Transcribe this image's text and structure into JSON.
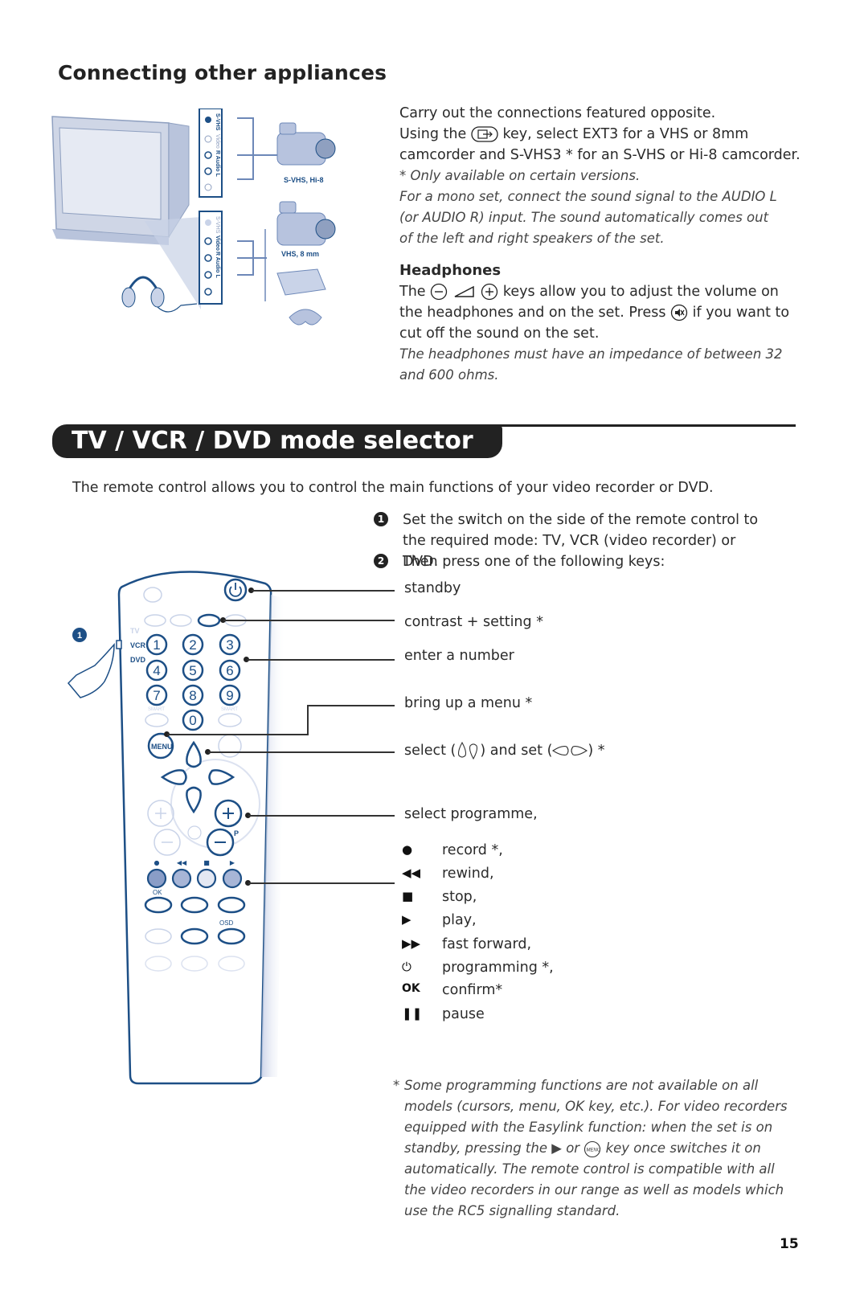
{
  "section1": {
    "title": "Connecting other appliances",
    "intro_line1": "Carry out the connections featured opposite.",
    "intro_line2_pre": "Using the",
    "intro_line2_post": "key, select EXT3 for a VHS or 8mm",
    "intro_line3": "camcorder and S-VHS3 * for an S-VHS or Hi-8 camcorder.",
    "note_versions": "* Only available on certain versions.",
    "mono_note": "For a mono set, connect the sound signal to the AUDIO L (or AUDIO R) input. The sound automatically comes out of the left and right speakers of the set.",
    "headphones_heading": "Headphones",
    "headphones_line1_pre": "The",
    "headphones_line1_post": "keys allow you to adjust the volume on",
    "headphones_line2_pre": "the headphones and on the set. Press",
    "headphones_line2_post": "if you want to",
    "headphones_line3": "cut off the sound on the set.",
    "impedance_note": "The headphones must have an impedance of between 32 and 600 ohms.",
    "icons": {
      "ext_key": "av-input-key-icon",
      "vol_minus": "minus-key-icon",
      "vol_wedge": "volume-icon",
      "vol_plus": "plus-key-icon",
      "mute": "mute-key-icon"
    },
    "illustration": {
      "panel_top_labels": [
        "S-VHS",
        "Video",
        "R Audio L"
      ],
      "panel_bottom_labels": [
        "S-VHS",
        "Video",
        "R Audio L"
      ],
      "caption_top": "S-VHS, Hi-8",
      "caption_bottom": "VHS, 8 mm"
    }
  },
  "section2": {
    "title": "TV / VCR / DVD mode selector",
    "lead": "The remote control allows you to control the main functions of your video recorder or DVD.",
    "steps": [
      {
        "num": "1",
        "text": "Set the switch on the side of the remote control to the required mode: TV, VCR (video recorder) or DVD."
      },
      {
        "num": "2",
        "text": "Then press one of the following keys:"
      }
    ],
    "callouts": [
      {
        "label": "standby"
      },
      {
        "label": "contrast + setting *"
      },
      {
        "label": "enter a number"
      },
      {
        "label": "bring up a menu *"
      },
      {
        "label_pre": "select (",
        "label_mid": ") and set (",
        "label_post": ") *"
      },
      {
        "label": "select programme,"
      }
    ],
    "legend": [
      {
        "symbol": "●",
        "icon": "record-icon",
        "text": "record *,"
      },
      {
        "symbol": "◀◀",
        "icon": "rewind-icon",
        "text": "rewind,"
      },
      {
        "symbol": "■",
        "icon": "stop-icon",
        "text": "stop,"
      },
      {
        "symbol": "▶",
        "icon": "play-icon",
        "text": "play,"
      },
      {
        "symbol": "▶▶",
        "icon": "fast-forward-icon",
        "text": "fast forward,"
      },
      {
        "symbol": "⏻",
        "icon": "timer-icon",
        "text": "programming *,"
      },
      {
        "symbol": "OK",
        "icon": "ok-icon",
        "text": "confirm*"
      },
      {
        "symbol": "❚❚",
        "icon": "pause-icon",
        "text": "pause"
      }
    ],
    "footnote_star": "*",
    "footnote_part1": "Some programming functions are not available on all models (cursors, menu, OK key, etc.). For video recorders equipped with the Easylink function: when the set is on standby, pressing the",
    "footnote_play": "▶",
    "footnote_or": "or",
    "footnote_part2": "key once switches it on automatically. The remote control is compatible with all the video recorders in our range as well as models which use the RC5 signalling standard.",
    "remote": {
      "switch_labels": [
        "TV",
        "VCR",
        "DVD"
      ],
      "marker": "1",
      "digits": [
        "1",
        "2",
        "3",
        "4",
        "5",
        "6",
        "7",
        "8",
        "9",
        "0"
      ],
      "smart_label": "SMART",
      "menu_label": "MENU",
      "p_label": "P",
      "ok_label": "OK",
      "osd_label": "OSD",
      "transport": [
        "●",
        "◀◀",
        "■",
        "▶"
      ]
    }
  },
  "page_number": "15",
  "colors": {
    "ink": "#222222",
    "remote_blue": "#1d4f86",
    "remote_light": "#c9d3e8",
    "remote_fill": "#eef1f8"
  }
}
